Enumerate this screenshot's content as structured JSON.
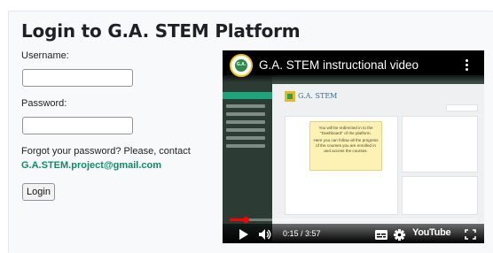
{
  "login": {
    "title": "Login to G.A. STEM Platform",
    "username_label": "Username:",
    "username_value": "",
    "password_label": "Password:",
    "password_value": "",
    "forgot_text": "Forgot your password? Please, contact",
    "contact_email": "G.A.STEM.project@gmail.com",
    "login_button": "Login"
  },
  "video": {
    "title": "G.A. STEM instructional video",
    "channel_logo_text": "G.A.",
    "current_time": "0:15 / 3:57",
    "progress": 0.064,
    "brand": "YouTube",
    "icons": [
      "play-icon",
      "volume-icon",
      "subtitles-icon",
      "settings-gear-icon",
      "fullscreen-icon",
      "more-options-icon"
    ],
    "embedded_screen": {
      "site_name": "G.A. STEM",
      "tooltip_line1": "You will be redirected in to the \"Dashboard\" of the platform.",
      "tooltip_line2": "Here you can follow all the progress of the courses you are enrolled in and access the courses."
    }
  },
  "colors": {
    "email_link": "#0f8b6b",
    "progress_red": "#ff0000",
    "card_bg": "#f8f9fa"
  }
}
